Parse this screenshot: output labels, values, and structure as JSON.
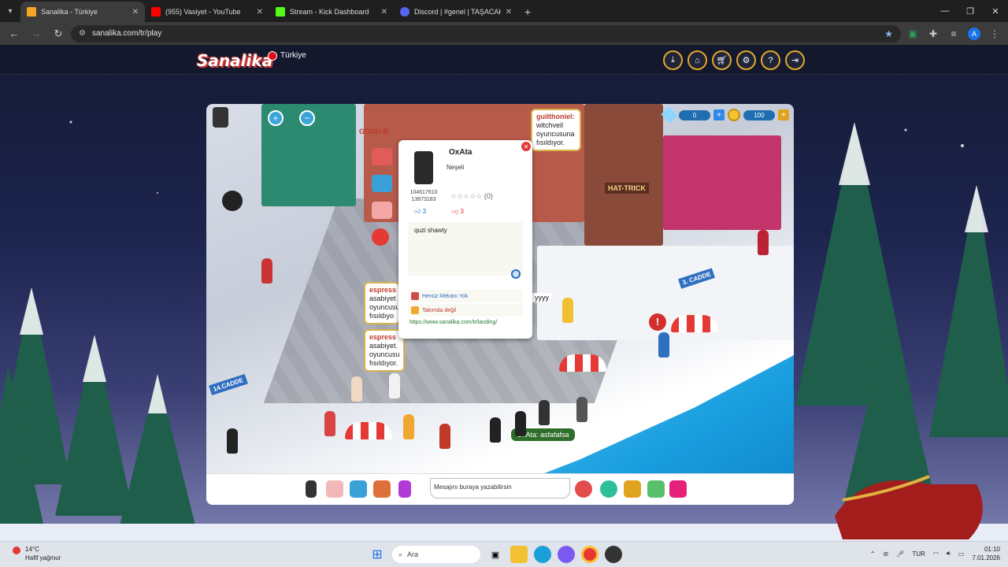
{
  "browser": {
    "tabs": [
      {
        "title": "Sanalika - Türkiye",
        "favicon_color": "#f5a623",
        "active": true
      },
      {
        "title": "(955) Vasiyet - YouTube",
        "favicon_color": "#ff0000",
        "active": false
      },
      {
        "title": "Stream - Kick Dashboard",
        "favicon_color": "#53fc18",
        "active": false
      },
      {
        "title": "Discord | #genel | TAŞACAK",
        "favicon_color": "#5865f2",
        "active": false
      }
    ],
    "url": "sanalika.com/tr/play",
    "profile_initial": "A"
  },
  "site": {
    "logo": "Sanalika",
    "region": "Türkiye",
    "top_buttons": [
      "download-icon",
      "home-icon",
      "cart-icon",
      "settings-icon",
      "help-icon",
      "logout-icon"
    ]
  },
  "game": {
    "gems": "0",
    "coins": "100",
    "speech_bubbles": [
      {
        "name": "guilthoniel:",
        "text": "witchveil oyuncusuna fısıldıyor."
      },
      {
        "name": "espress",
        "text": "asabiyet oyuncusu fısıldıyo"
      },
      {
        "name": "espress",
        "text": "asabiyet. oyuncusu fısıldıyor."
      }
    ],
    "overhead_text": "yyyy",
    "chat_bubble": "OxAta: asfafafsa",
    "street_sign_1": "14.CADDE",
    "street_sign_2": "3. CADDE",
    "shop_sign_1": "GOOD-B",
    "shop_sign_2": "HAT-TRICK",
    "chat_placeholder": "Mesajını buraya yazabilirsin"
  },
  "profile_card": {
    "username": "OxAta",
    "status": "Neşeli",
    "id_line1": "104617610",
    "id_line2": "13873183",
    "rating_count": "(0)",
    "likes": "3",
    "dislikes": "3",
    "about": "quzi shawty",
    "place": "Henüz Mekanı Yok",
    "team": "Takımda değil",
    "link": "https://www.sanalika.com/tr/landing/"
  },
  "taskbar": {
    "temp": "14°C",
    "weather": "Hafif yağmur",
    "search_label": "Ara",
    "lang": "TUR",
    "time": "01:10",
    "date": "7.01.2026"
  }
}
